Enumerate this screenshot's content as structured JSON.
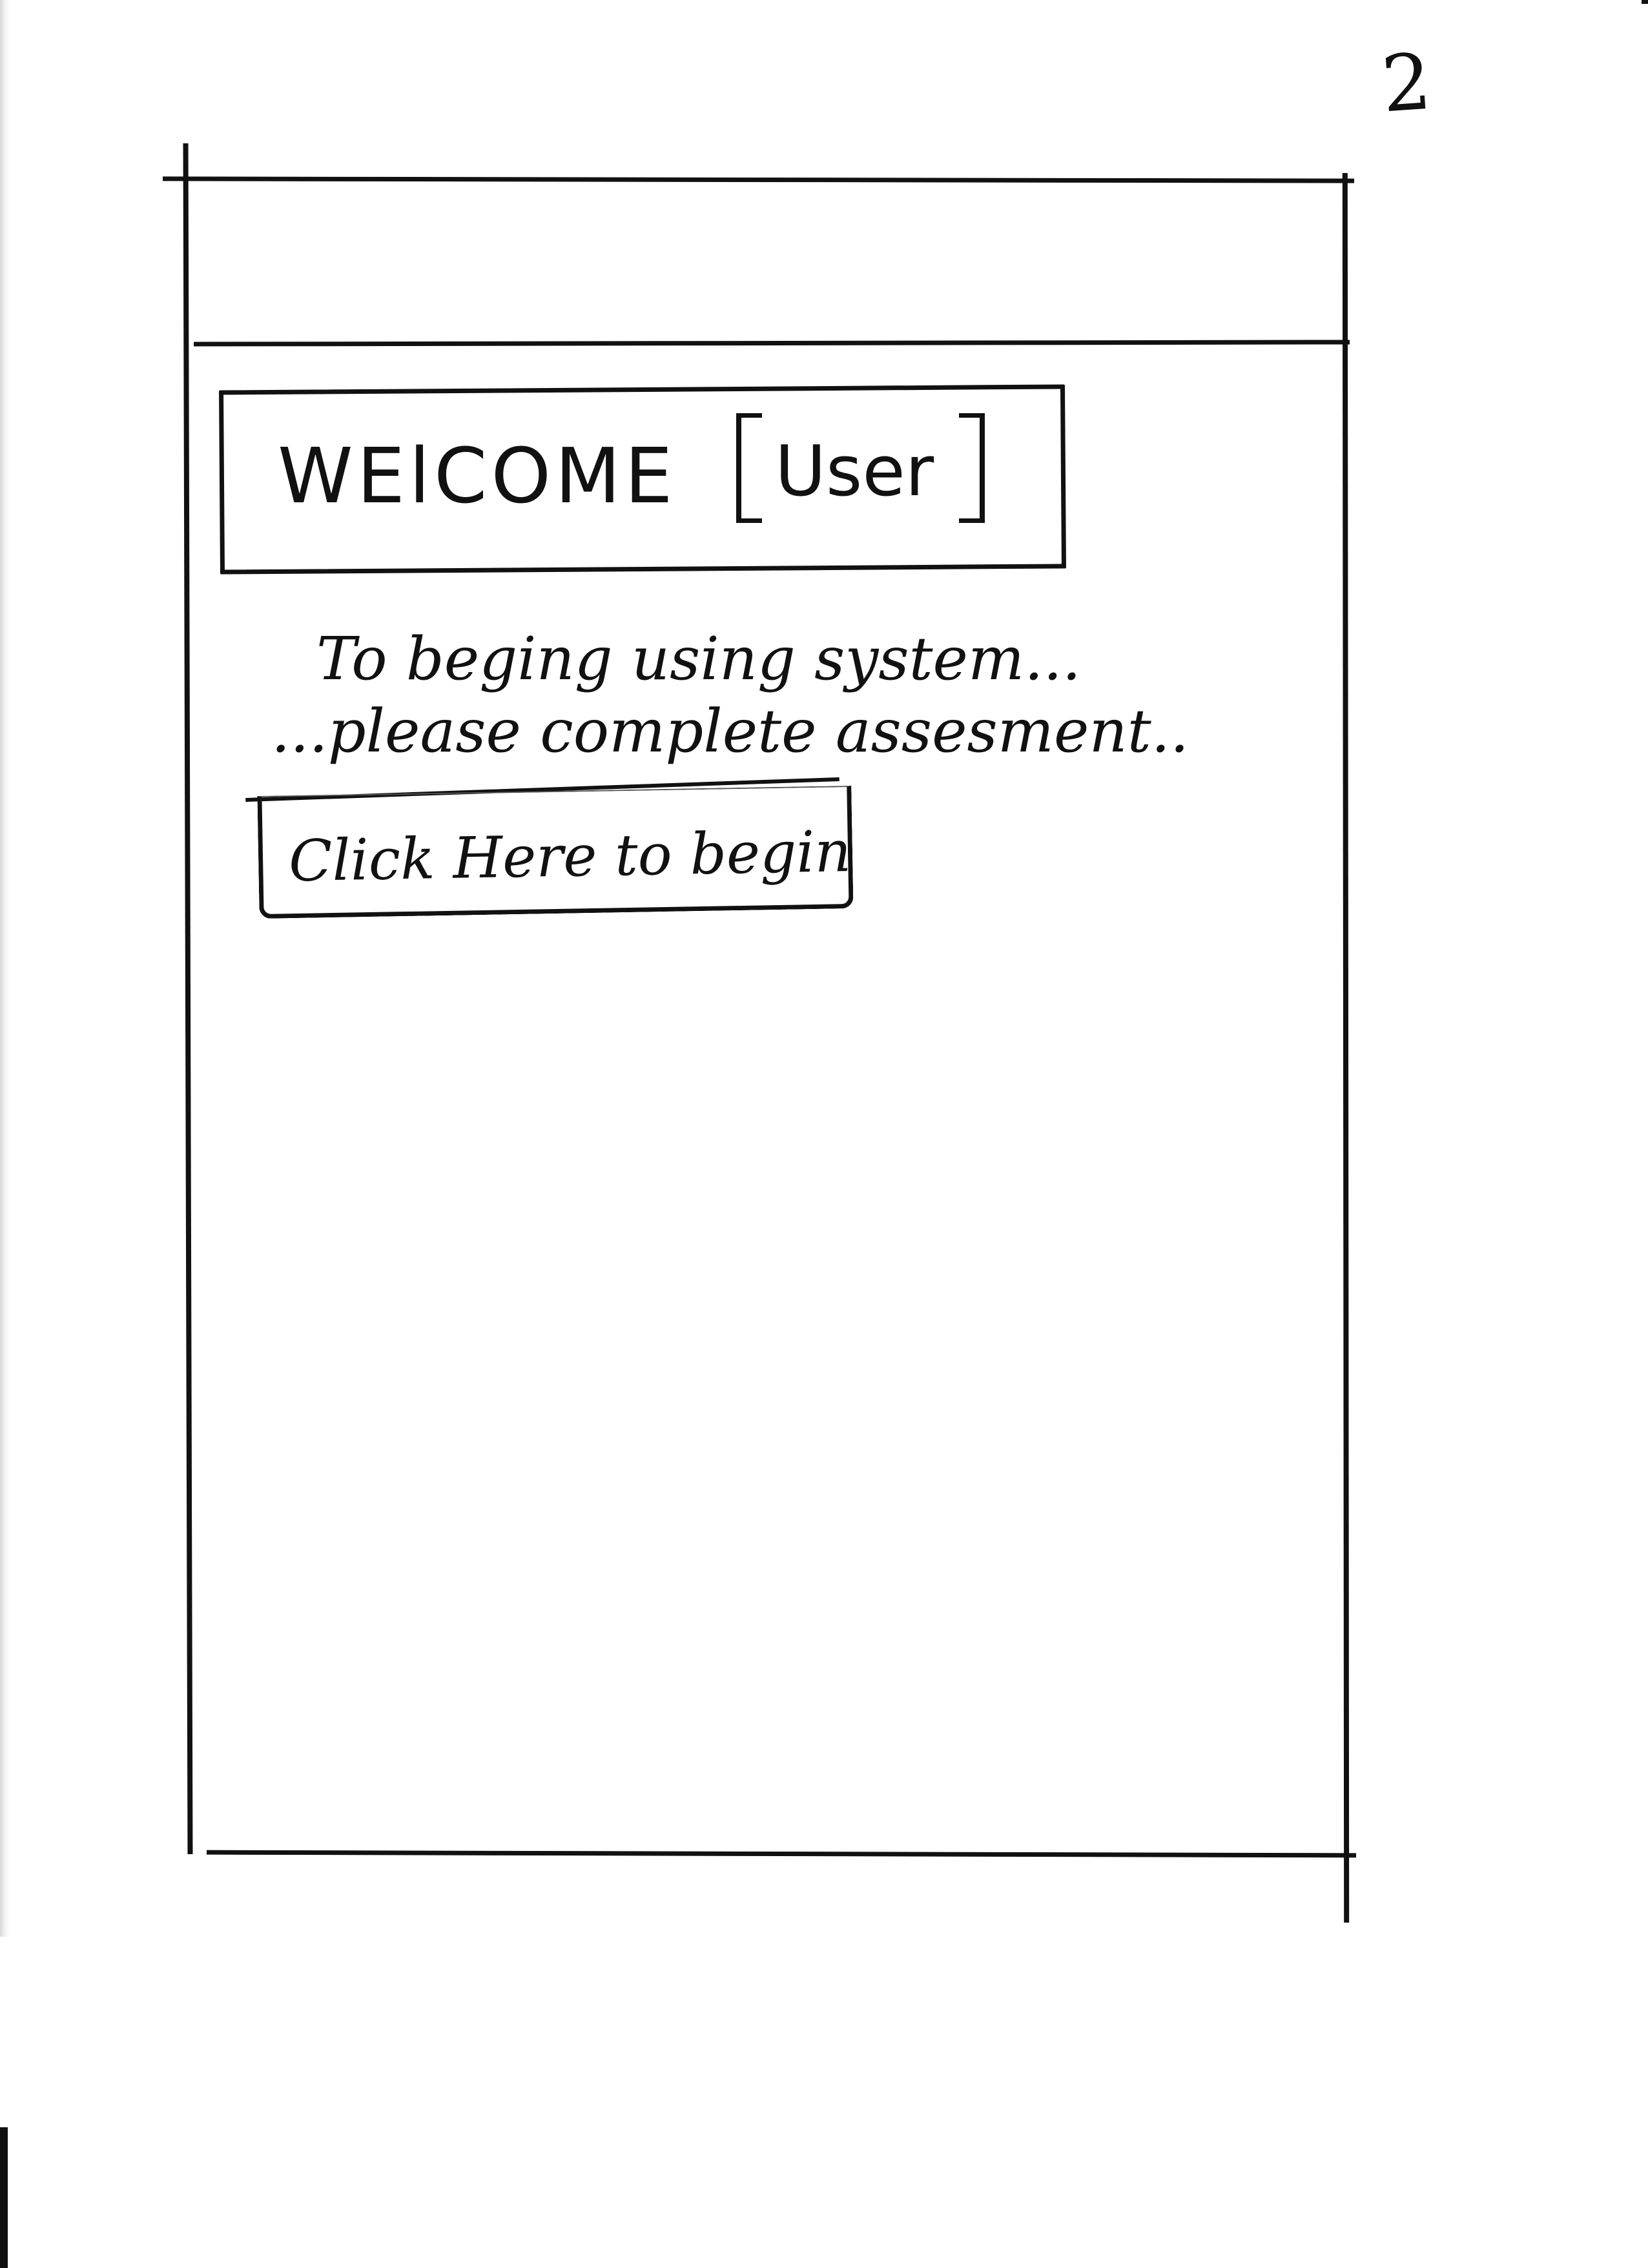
{
  "page_number": "2",
  "screen": {
    "welcome": {
      "title": "WElCOME",
      "user_placeholder": "User"
    },
    "instructions": {
      "line_1": "To beging using system...",
      "line_2": "...please complete assesment.."
    },
    "begin_button": {
      "label": "Click Here to begin"
    }
  }
}
